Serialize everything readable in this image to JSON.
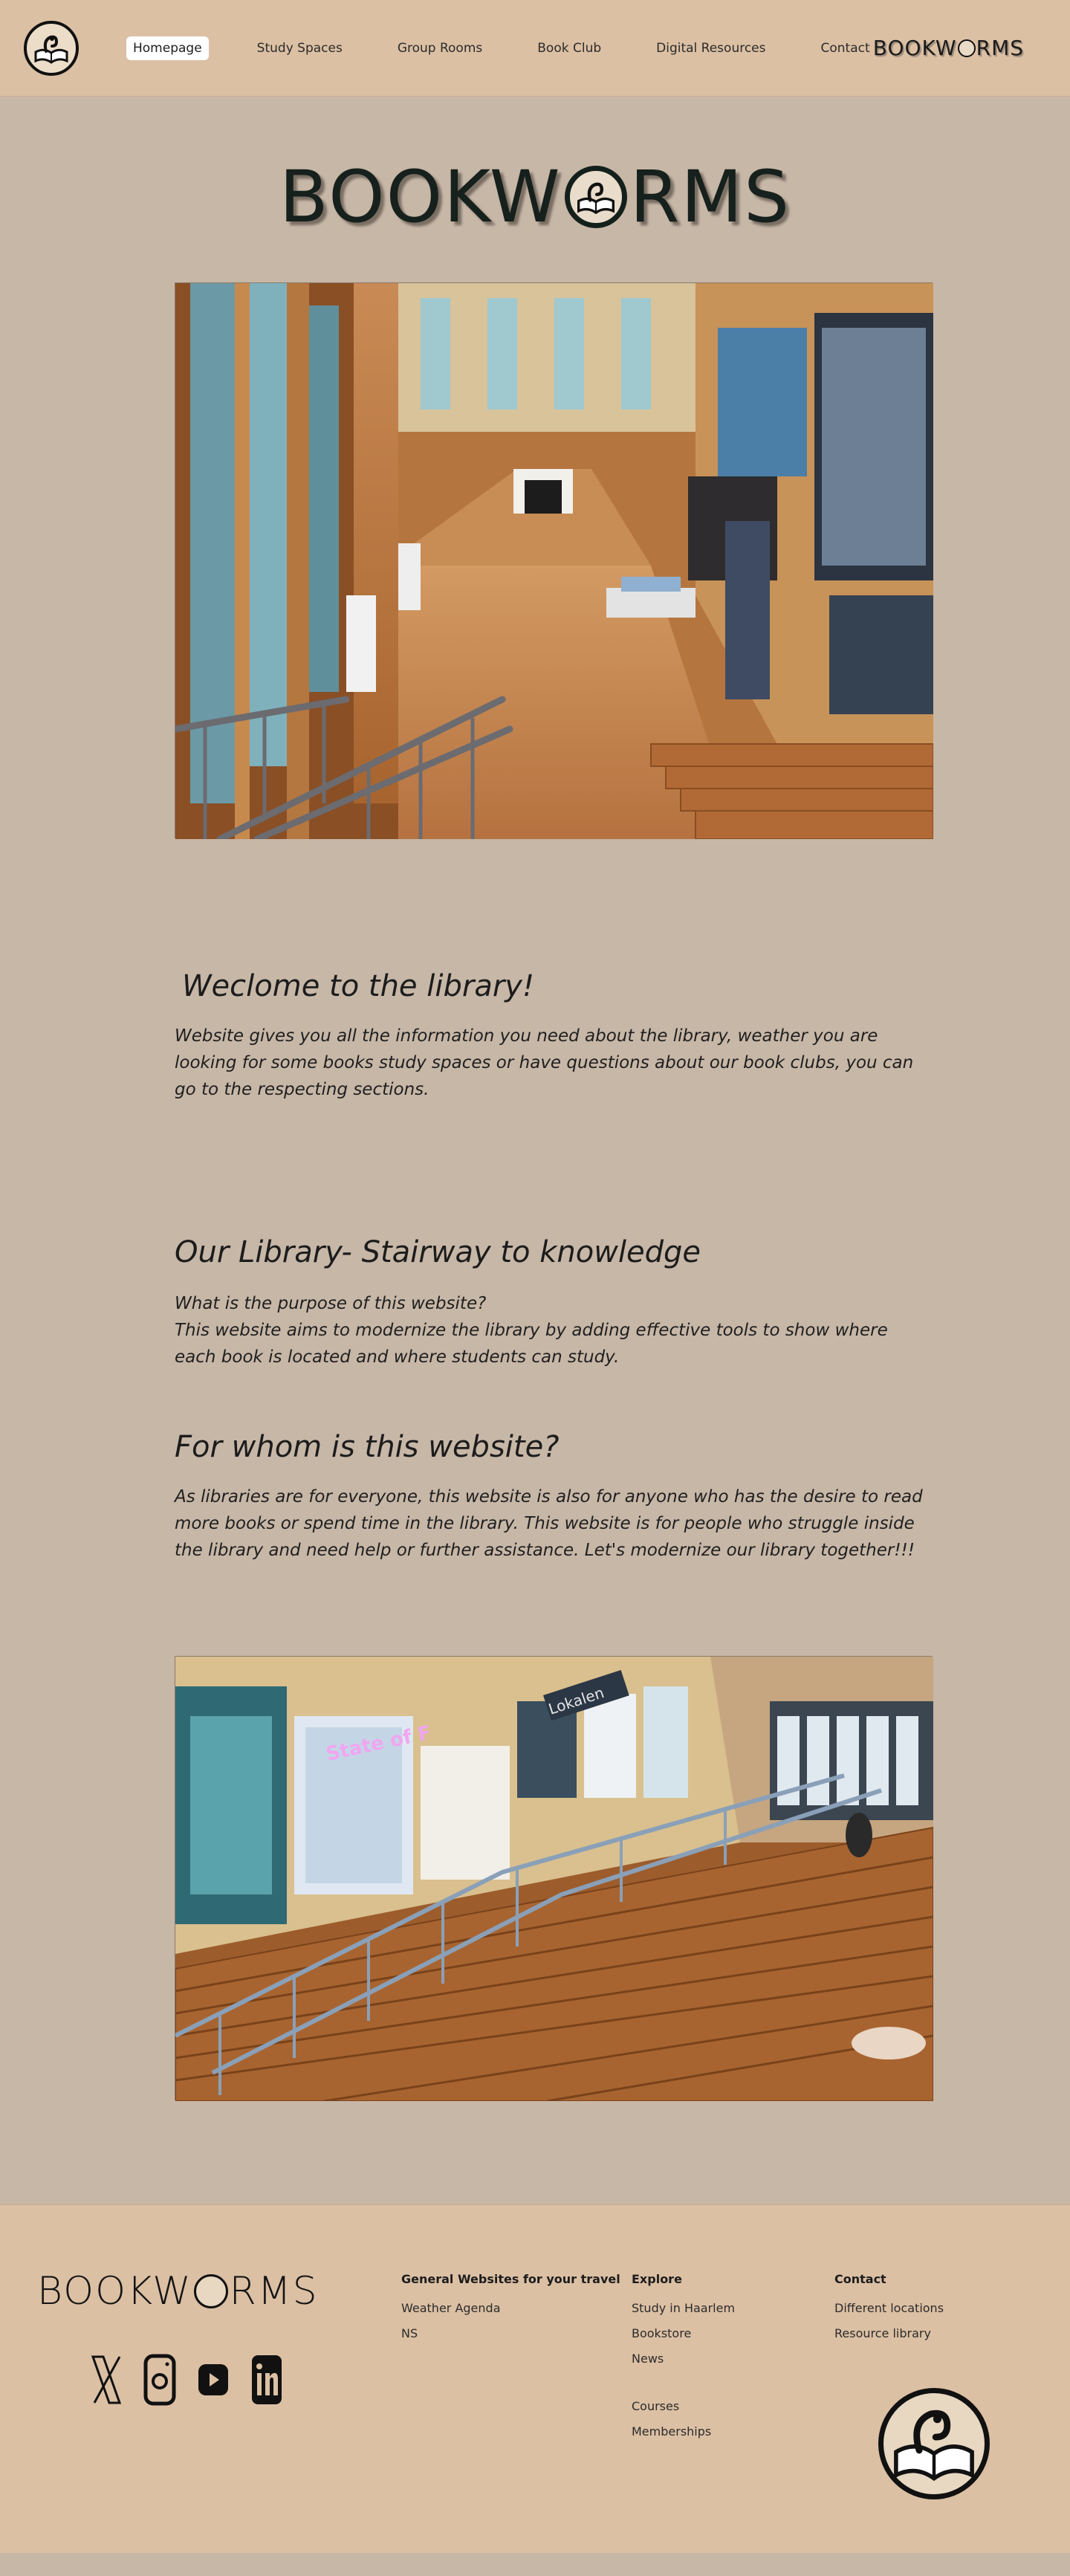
{
  "header": {
    "logo_icon": "bookworm-logo-icon",
    "nav": [
      {
        "label": "Homepage",
        "active": true
      },
      {
        "label": "Study Spaces",
        "active": false
      },
      {
        "label": "Group Rooms",
        "active": false
      },
      {
        "label": "Book Club",
        "active": false
      },
      {
        "label": "Digital Resources",
        "active": false
      },
      {
        "label": "Contact",
        "active": false
      }
    ],
    "wordmark_left": "BOOKW",
    "wordmark_right": "RMS"
  },
  "hero": {
    "wordmark_left": "BOOKW",
    "wordmark_right": "RMS"
  },
  "welcome": {
    "title": "Weclome to the library!",
    "body": "Website gives you all the information you need about the library, weather you are looking for some books study spaces or have questions about our book clubs, you can go to the respecting sections."
  },
  "about": {
    "title": "Our Library- Stairway to knowledge",
    "question": "What is the purpose of this website?",
    "body": "This website aims to modernize the library by adding effective tools to show where each book is located and where students can study."
  },
  "audience": {
    "title": "For whom is this website?",
    "body": "As libraries are for everyone, this website is also for anyone who has the desire to read more books or spend time in the library. This website is for people who struggle inside the library and need help or further assistance. Let's modernize our library together!!!"
  },
  "photo2_signs": {
    "sign1": "State of F",
    "sign2": "Lokalen"
  },
  "footer": {
    "wordmark_left": "BOOKW",
    "wordmark_right": "RMS",
    "socials": [
      "x-icon",
      "instagram-icon",
      "youtube-icon",
      "linkedin-icon"
    ],
    "col1": {
      "heading": "General Websites for your travel",
      "links": [
        "Weather Agenda",
        "NS"
      ]
    },
    "col2": {
      "heading": "Explore",
      "links": [
        "Study in Haarlem",
        "Bookstore",
        "News"
      ],
      "links2": [
        "Courses",
        "Memberships"
      ]
    },
    "col3": {
      "heading": "Contact",
      "links": [
        "Different locations",
        "Resource library"
      ]
    }
  },
  "colors": {
    "page_bg": "#c7b7a7",
    "header_bg": "#dcc0a4",
    "text": "#1e1e1e"
  }
}
